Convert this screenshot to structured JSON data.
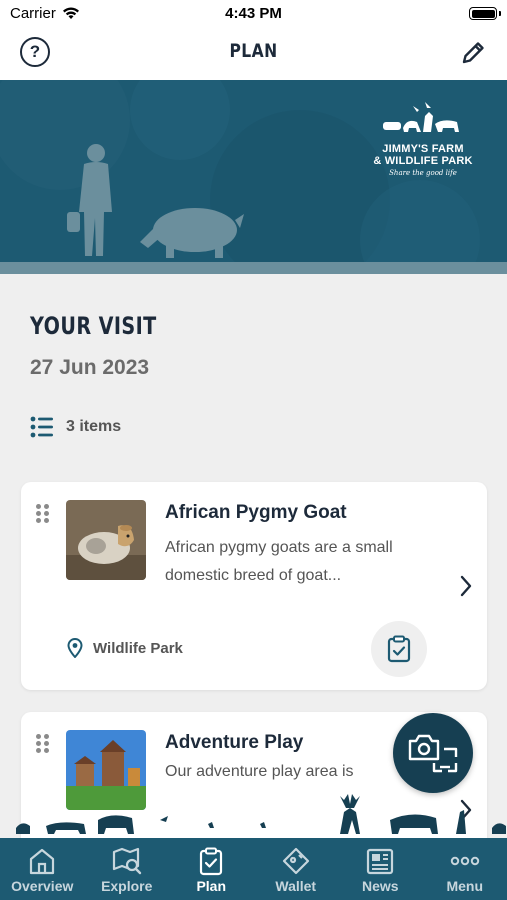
{
  "status_bar": {
    "carrier": "Carrier",
    "time": "4:43 PM"
  },
  "nav": {
    "title": "PLAN",
    "help_symbol": "?"
  },
  "hero": {
    "logo_line1": "JIMMY'S FARM",
    "logo_line2": "& WILDLIFE PARK",
    "logo_tagline": "Share the good life"
  },
  "visit": {
    "title": "YOUR VISIT",
    "date": "27 Jun 2023",
    "items_count": "3 items"
  },
  "cards": [
    {
      "title": "African Pygmy Goat",
      "description": "African pygmy goats are a small domestic breed of goat...",
      "location": "Wildlife Park",
      "thumb": "goat-photo"
    },
    {
      "title": "Adventure Play",
      "description": "Our adventure play area is",
      "thumb": "play-area-photo"
    }
  ],
  "tabs": [
    {
      "label": "Overview",
      "icon": "house-icon",
      "active": false
    },
    {
      "label": "Explore",
      "icon": "map-search-icon",
      "active": false
    },
    {
      "label": "Plan",
      "icon": "clipboard-check-icon",
      "active": true
    },
    {
      "label": "Wallet",
      "icon": "ticket-icon",
      "active": false
    },
    {
      "label": "News",
      "icon": "newspaper-icon",
      "active": false
    },
    {
      "label": "Menu",
      "icon": "more-icon",
      "active": false
    }
  ],
  "colors": {
    "brand_teal": "#1d5a72",
    "dark_teal": "#163f52",
    "text_navy": "#1d2a3a",
    "background": "#efefef"
  }
}
